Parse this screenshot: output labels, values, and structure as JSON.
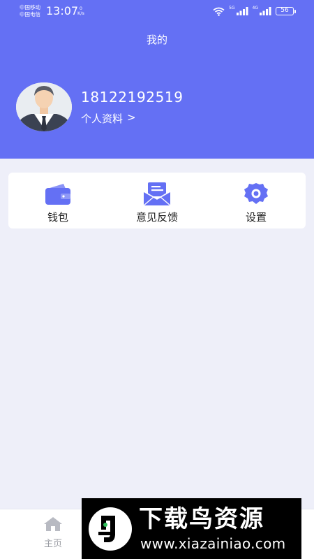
{
  "status_bar": {
    "carrier_1": "中国移动",
    "carrier_2": "中国电信",
    "time": "13:07",
    "net_speed_value": "0",
    "net_speed_unit": "K/s",
    "sim1_network": "5G",
    "sim2_network": "4G",
    "battery": "56"
  },
  "header": {
    "title": "我的",
    "background_color": "#6470f4"
  },
  "profile": {
    "phone": "18122192519",
    "link_label": "个人资料",
    "link_arrow": ">",
    "avatar_icon": "user-avatar"
  },
  "menu": [
    {
      "label": "钱包",
      "icon": "wallet-icon"
    },
    {
      "label": "意见反馈",
      "icon": "feedback-mail-icon"
    },
    {
      "label": "设置",
      "icon": "gear-icon"
    }
  ],
  "bottom_nav": {
    "home_label": "主页",
    "home_icon": "home-icon"
  },
  "watermark": {
    "title": "下载鸟资源",
    "url": "www.xiazainiao.com"
  },
  "colors": {
    "accent": "#6470f4",
    "page_background": "#eeeff9",
    "card_background": "#ffffff",
    "inactive_tab": "#9a9ca3"
  }
}
